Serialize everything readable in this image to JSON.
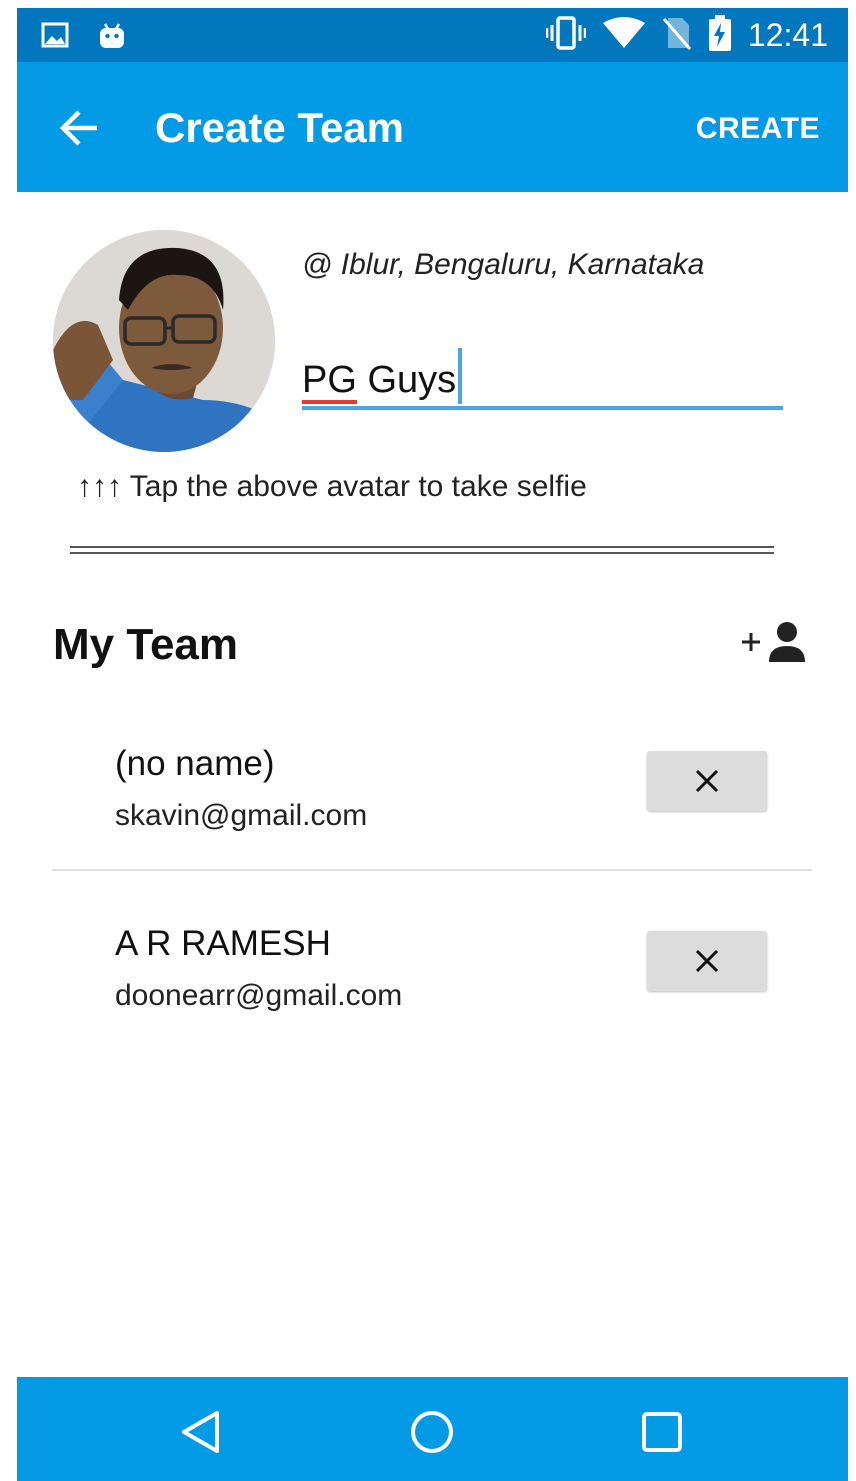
{
  "status_bar": {
    "time": "12:41",
    "icons": [
      "image-icon",
      "android-icon",
      "vibrate-icon",
      "wifi-icon",
      "no-sim-icon",
      "battery-charging-icon"
    ]
  },
  "app_bar": {
    "title": "Create Team",
    "action_label": "CREATE",
    "back_icon": "arrow-left-icon"
  },
  "profile": {
    "location": "@ Iblur, Bengaluru, Karnataka",
    "team_name_part1": "PG",
    "team_name_part2": " Guys",
    "hint": "↑↑↑ Tap the above avatar to take selfie"
  },
  "team": {
    "heading": "My Team",
    "add_icon": "add-person-icon",
    "members": [
      {
        "name": "(no name)",
        "email": "skavin@gmail.com"
      },
      {
        "name": "A R RAMESH",
        "email": "doonearr@gmail.com"
      }
    ],
    "remove_icon": "close-icon"
  },
  "nav_bar": {
    "icons": [
      "back-triangle-icon",
      "home-circle-icon",
      "recents-square-icon"
    ]
  },
  "colors": {
    "status_bar": "#0277bd",
    "app_bar": "#039be5",
    "input_accent": "#4aa8de",
    "spellcheck": "#e53935"
  }
}
